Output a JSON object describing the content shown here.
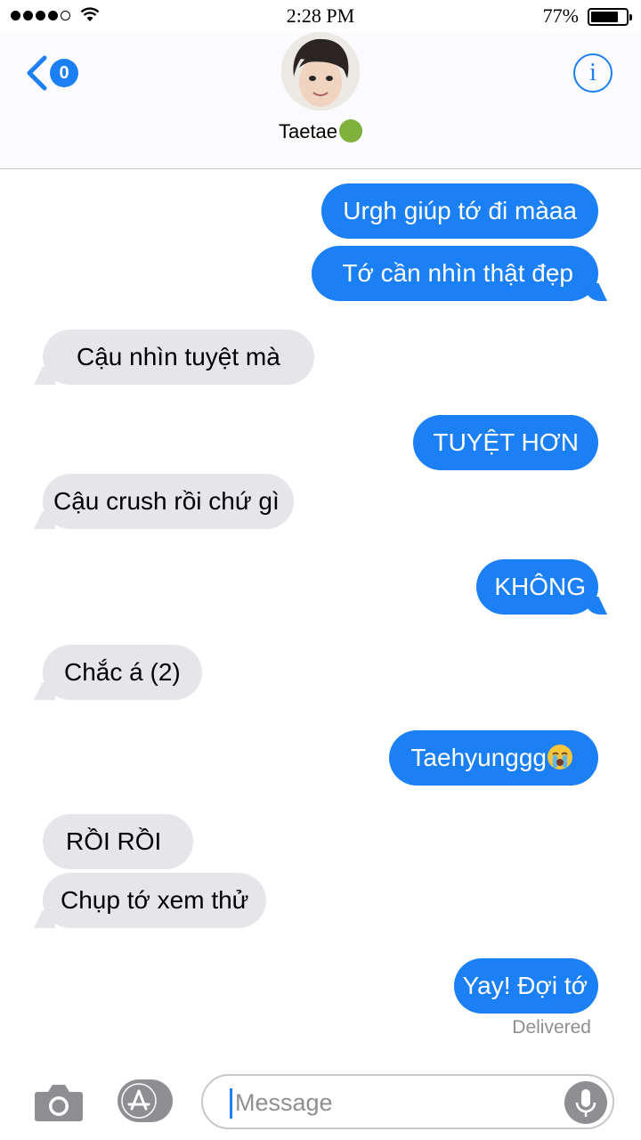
{
  "status_bar": {
    "time": "2:28 PM",
    "battery_percent": "77%",
    "signal_bars": 5,
    "signal_filled": 4
  },
  "header": {
    "back_badge": "0",
    "contact_name": "Taetae",
    "contact_emoji": "nauseated-face-emoji",
    "info_label": "i"
  },
  "messages": [
    {
      "side": "sent",
      "text": "Urgh giúp tớ đi màaa"
    },
    {
      "side": "sent",
      "text": "Tớ cần nhìn thật đẹp"
    },
    {
      "side": "recv",
      "text": "Cậu nhìn tuyệt mà"
    },
    {
      "side": "sent",
      "text": "TUYỆT HƠN"
    },
    {
      "side": "recv",
      "text": "Cậu crush rồi chứ gì"
    },
    {
      "side": "sent",
      "text": "KHÔNG"
    },
    {
      "side": "recv",
      "text": "Chắc á (2)"
    },
    {
      "side": "sent",
      "text": "Taehyunggg",
      "emoji": "loudly-crying-face-emoji"
    },
    {
      "side": "recv",
      "text": "RỒI RỒI"
    },
    {
      "side": "recv",
      "text": "Chụp tớ xem thử"
    },
    {
      "side": "sent",
      "text": "Yay! Đợi tớ"
    }
  ],
  "delivered_label": "Delivered",
  "input": {
    "placeholder": "Message",
    "camera_icon": "camera-icon",
    "apps_icon": "app-store-icon",
    "mic_icon": "microphone-icon"
  },
  "colors": {
    "sent_bubble": "#1b7ff5",
    "recv_bubble": "#e5e5ea",
    "accent": "#1b7ff5"
  }
}
